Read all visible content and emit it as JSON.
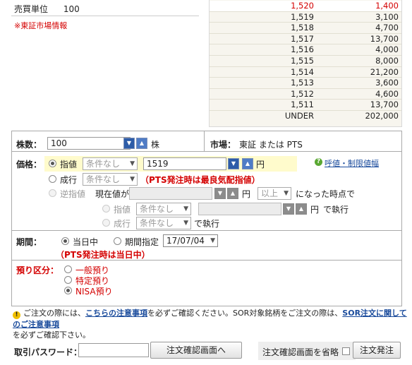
{
  "header": {
    "trading_unit_label": "売買単位",
    "trading_unit_value": "100",
    "tse_note": "※東証市場情報"
  },
  "board": {
    "rows": [
      {
        "price": "1,520",
        "qty": "1,400"
      },
      {
        "price": "1,519",
        "qty": "3,100"
      },
      {
        "price": "1,518",
        "qty": "4,700"
      },
      {
        "price": "1,517",
        "qty": "13,700"
      },
      {
        "price": "1,516",
        "qty": "4,000"
      },
      {
        "price": "1,515",
        "qty": "8,000"
      },
      {
        "price": "1,514",
        "qty": "21,200"
      },
      {
        "price": "1,513",
        "qty": "3,600"
      },
      {
        "price": "1,512",
        "qty": "4,600"
      },
      {
        "price": "1,511",
        "qty": "13,700"
      },
      {
        "price": "UNDER",
        "qty": "202,000"
      }
    ],
    "highlight_color": "#d40000"
  },
  "order": {
    "shares_label": "株数：",
    "shares_value": "100",
    "shares_unit": "株",
    "market_label": "市場：",
    "market_value": "東証 または PTS",
    "price_label": "価格：",
    "limit_label": "指値",
    "condition_placeholder": "条件なし",
    "price_value": "1519",
    "yen": "円",
    "limit_help_link": "呼値・制限値幅",
    "market_order_label": "成行",
    "pts_limit_note": "（PTS発注時は最良気配指値）",
    "stop_label": "逆指値",
    "current_price_label": "現在値が",
    "above_option": "以上",
    "trigger_suffix": "になった時点で",
    "execute_suffix": "で執行",
    "market_execute_suffix": "で執行",
    "period_label": "期間：",
    "today_label": "当日中",
    "date_specified_label": "期間指定",
    "date_value": "17/07/04",
    "pts_period_note": "（PTS発注時は当日中）",
    "account_label": "預り区分：",
    "account_general": "一般預り",
    "account_specific": "特定預り",
    "account_nisa": "NISA預り"
  },
  "notice": {
    "part1": "ご注文の際には、",
    "link1": "こちらの注意事項",
    "part2": "を必ずご確認ください。SOR対象銘柄をご注文の際は、",
    "link2": "SOR注文に関してのご注意事項",
    "part3": "を必ずご確認下さい。"
  },
  "footer": {
    "password_label": "取引パスワード：",
    "confirm_button": "注文確認画面へ",
    "skip_label": "注文確認画面を省略",
    "submit_button": "注文発注"
  }
}
